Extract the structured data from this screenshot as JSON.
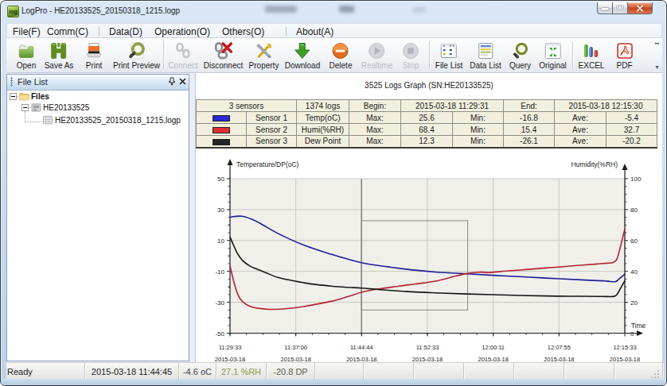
{
  "window": {
    "icon_text": "log",
    "title": "LogPro - HE20133525_20150318_1215.logp"
  },
  "menu": {
    "items": [
      "File(F)",
      "Comm(C)",
      "Data(D)",
      "Operation(O)",
      "Others(O)",
      "About(A)"
    ],
    "separators_after": [
      1,
      4
    ]
  },
  "toolbar": {
    "buttons": [
      {
        "label": "Open",
        "icon": "open-folder",
        "disabled": false
      },
      {
        "label": "Save As",
        "icon": "save",
        "disabled": false
      },
      {
        "label": "Print",
        "icon": "print",
        "disabled": false
      },
      {
        "label": "Print Preview",
        "icon": "print-preview",
        "disabled": false
      },
      {
        "label": "Connect",
        "icon": "connect",
        "disabled": true,
        "sep_before": true
      },
      {
        "label": "Disconnect",
        "icon": "disconnect",
        "disabled": false
      },
      {
        "label": "Property",
        "icon": "property",
        "disabled": false
      },
      {
        "label": "Download",
        "icon": "download",
        "disabled": false
      },
      {
        "label": "Delete",
        "icon": "delete",
        "disabled": false
      },
      {
        "label": "Realtime",
        "icon": "realtime",
        "disabled": true
      },
      {
        "label": "Stop",
        "icon": "stop",
        "disabled": true
      },
      {
        "label": "File List",
        "icon": "file-list",
        "disabled": false,
        "sep_before": true
      },
      {
        "label": "Data List",
        "icon": "data-list",
        "disabled": false
      },
      {
        "label": "Query",
        "icon": "query",
        "disabled": false
      },
      {
        "label": "Original",
        "icon": "original",
        "disabled": false
      },
      {
        "label": "EXCEL",
        "icon": "excel",
        "disabled": false,
        "sep_before": true
      },
      {
        "label": "PDF",
        "icon": "pdf",
        "disabled": false
      }
    ]
  },
  "file_panel": {
    "title": "File List",
    "tree": [
      {
        "label": "Files",
        "level": 0,
        "bold": true,
        "icon": "folder",
        "expander": true
      },
      {
        "label": "HE20133525",
        "level": 1,
        "bold": false,
        "icon": "device",
        "expander": true
      },
      {
        "label": "HE20133525_20150318_1215.logp",
        "level": 2,
        "bold": false,
        "icon": "log-file",
        "expander": false
      }
    ]
  },
  "document": {
    "title": "3525 Logs Graph (SN:HE20133525)",
    "summary": {
      "sensors": "3 sensors",
      "logs": "1374 logs",
      "begin_label": "Begin:",
      "begin": "2015-03-18 11:29:31",
      "end_label": "End:",
      "end": "2015-03-18 12:15:30"
    },
    "sensor_rows": [
      {
        "color": "#2929cf",
        "name": "Sensor 1",
        "type": "Temp(oC)",
        "max_label": "Max:",
        "max": "25.6",
        "min_label": "Min:",
        "min": "-16.8",
        "ave_label": "Ave:",
        "ave": "-5.4"
      },
      {
        "color": "#e02f2f",
        "name": "Sensor 2",
        "type": "Humi(%RH)",
        "max_label": "Max:",
        "max": "68.4",
        "min_label": "Min:",
        "min": "15.4",
        "ave_label": "Ave:",
        "ave": "32.7"
      },
      {
        "color": "#262626",
        "name": "Sensor 3",
        "type": "Dew Point",
        "max_label": "Max:",
        "max": "12.3",
        "min_label": "Min:",
        "min": "-26.1",
        "ave_label": "Ave:",
        "ave": "-20.2"
      }
    ]
  },
  "chart_data": {
    "type": "line",
    "title": "",
    "left_axis": {
      "label": "Temperature/DP(oC)",
      "ticks": [
        50,
        30,
        10,
        -10,
        -30,
        -50
      ],
      "range": [
        -50,
        50
      ]
    },
    "right_axis": {
      "label": "Humidity(%RH)",
      "ticks": [
        100,
        80,
        60,
        40,
        20,
        0
      ],
      "range": [
        0,
        100
      ]
    },
    "x_axis": {
      "label": "Time",
      "ticks": [
        "11:29:33",
        "11:37:00",
        "11:44:44",
        "11:52:33",
        "12:00:11",
        "12:07:55",
        "12:15:33"
      ],
      "tick_dates": [
        "2015-03-18",
        "2015-03-18",
        "2015-03-18",
        "2015-03-18",
        "2015-03-18",
        "2015-03-18",
        "2015-03-18"
      ]
    },
    "cursor_t": 0.333,
    "selection_rect": {
      "t0": 0.333,
      "t1": 0.602,
      "v0": 22.8,
      "v1": -35.0
    },
    "series": [
      {
        "name": "Temp(oC)",
        "color": "#1d1d93",
        "axis": "left",
        "points": [
          [
            0,
            25.1
          ],
          [
            0.03,
            25.7
          ],
          [
            0.067,
            22.4
          ],
          [
            0.121,
            14.6
          ],
          [
            0.188,
            6.9
          ],
          [
            0.256,
            1.1
          ],
          [
            0.333,
            -4.4
          ],
          [
            0.4,
            -7.0
          ],
          [
            0.458,
            -8.9
          ],
          [
            0.52,
            -10.4
          ],
          [
            0.6,
            -11.6
          ],
          [
            0.7,
            -13.0
          ],
          [
            0.8,
            -14.3
          ],
          [
            0.9,
            -15.6
          ],
          [
            0.95,
            -16.2
          ],
          [
            0.975,
            -16.7
          ],
          [
            0.985,
            -15.0
          ],
          [
            1.0,
            -11.8
          ]
        ]
      },
      {
        "name": "Humi(%RH)",
        "color": "#b02230",
        "axis": "right",
        "points": [
          [
            0,
            43.8
          ],
          [
            0.006,
            37.0
          ],
          [
            0.015,
            28.5
          ],
          [
            0.025,
            22.5
          ],
          [
            0.04,
            18.8
          ],
          [
            0.055,
            17.0
          ],
          [
            0.075,
            16.0
          ],
          [
            0.1,
            15.4
          ],
          [
            0.13,
            15.6
          ],
          [
            0.16,
            16.3
          ],
          [
            0.19,
            17.4
          ],
          [
            0.22,
            18.8
          ],
          [
            0.256,
            20.6
          ],
          [
            0.29,
            23.0
          ],
          [
            0.31,
            24.6
          ],
          [
            0.333,
            26.5
          ],
          [
            0.37,
            28.4
          ],
          [
            0.42,
            30.2
          ],
          [
            0.47,
            31.9
          ],
          [
            0.52,
            33.7
          ],
          [
            0.57,
            36.9
          ],
          [
            0.6,
            38.6
          ],
          [
            0.63,
            39.5
          ],
          [
            0.66,
            39.3
          ],
          [
            0.7,
            40.2
          ],
          [
            0.75,
            41.2
          ],
          [
            0.8,
            42.2
          ],
          [
            0.85,
            43.2
          ],
          [
            0.9,
            44.2
          ],
          [
            0.93,
            44.8
          ],
          [
            0.955,
            45.3
          ],
          [
            0.97,
            45.8
          ],
          [
            0.98,
            48.0
          ],
          [
            0.99,
            57.0
          ],
          [
            1.0,
            67.5
          ]
        ]
      },
      {
        "name": "Dew Point",
        "color": "#161616",
        "axis": "left",
        "points": [
          [
            0,
            12.3
          ],
          [
            0.008,
            7.5
          ],
          [
            0.018,
            2.0
          ],
          [
            0.03,
            -2.5
          ],
          [
            0.05,
            -6.5
          ],
          [
            0.067,
            -8.4
          ],
          [
            0.09,
            -10.8
          ],
          [
            0.121,
            -13.9
          ],
          [
            0.155,
            -15.8
          ],
          [
            0.188,
            -17.4
          ],
          [
            0.22,
            -18.6
          ],
          [
            0.256,
            -19.5
          ],
          [
            0.29,
            -20.2
          ],
          [
            0.333,
            -20.8
          ],
          [
            0.38,
            -21.8
          ],
          [
            0.458,
            -23.2
          ],
          [
            0.52,
            -23.9
          ],
          [
            0.6,
            -24.6
          ],
          [
            0.7,
            -25.3
          ],
          [
            0.8,
            -25.9
          ],
          [
            0.88,
            -26.1
          ],
          [
            0.94,
            -26.2
          ],
          [
            0.97,
            -26.3
          ],
          [
            0.98,
            -25.0
          ],
          [
            0.99,
            -20.5
          ],
          [
            1.0,
            -16.0
          ]
        ]
      }
    ]
  },
  "status_bar": {
    "ready": "Ready",
    "datetime": "2015-03-18 11:44:45",
    "temp": "-4.6 oC",
    "humi": "27.1 %RH",
    "dp": "-20.8 DP",
    "temp_color": "#43434e",
    "humi_color": "#8d9a45",
    "dp_color": "#5f6147"
  }
}
